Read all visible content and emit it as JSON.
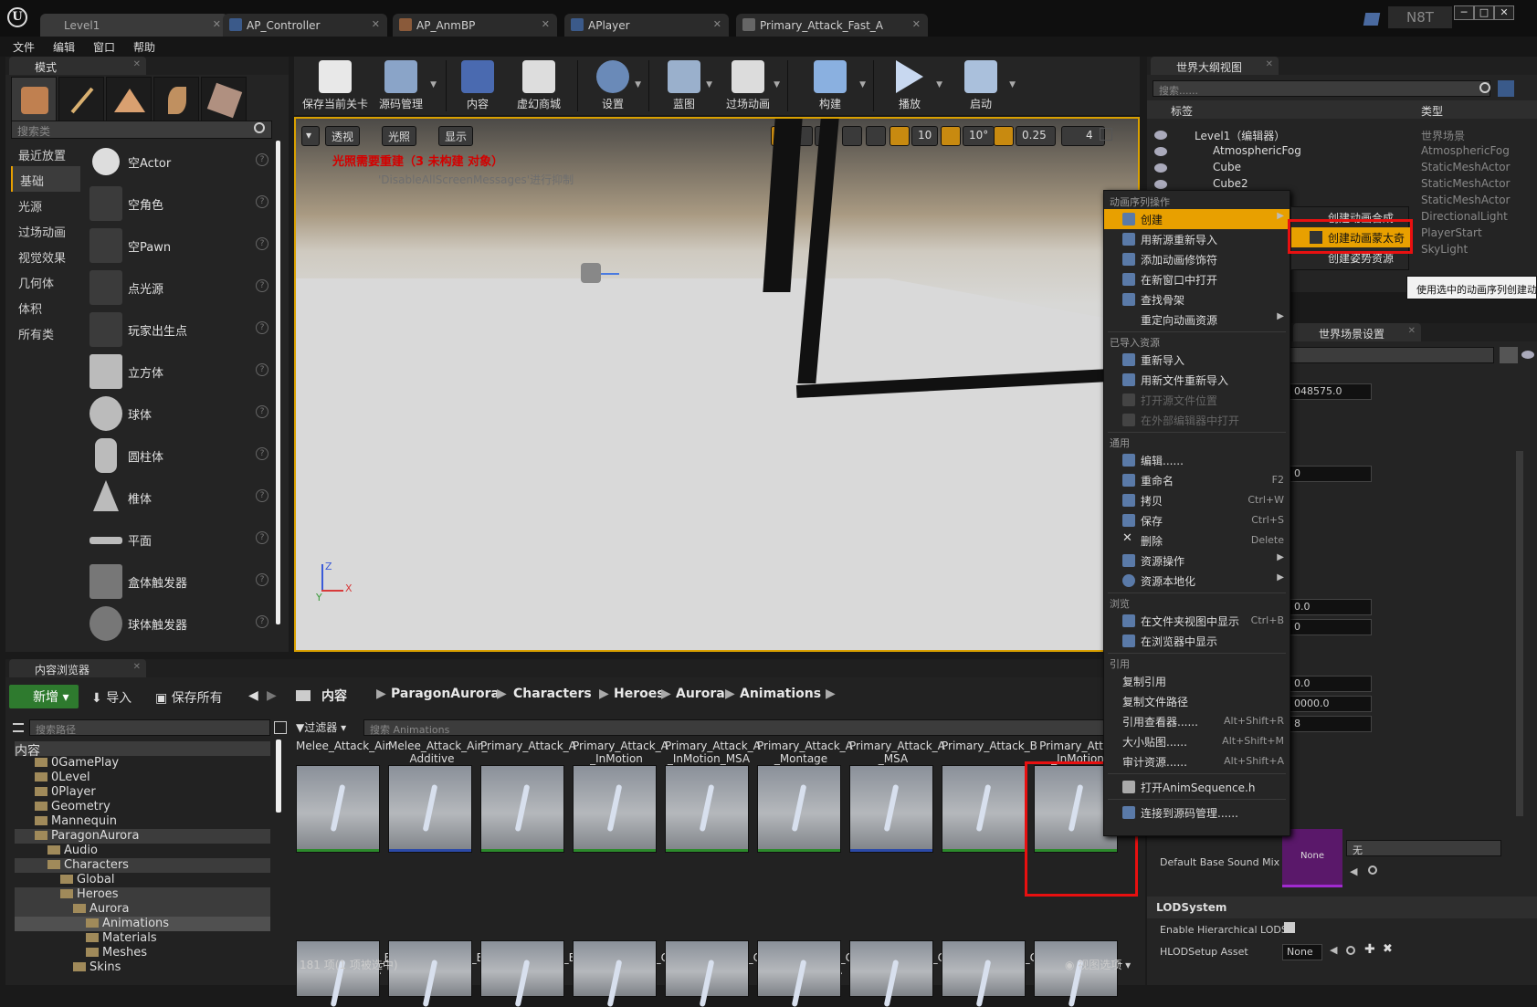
{
  "window": {
    "tabs": [
      {
        "label": "Level1"
      },
      {
        "label": "AP_Controller"
      },
      {
        "label": "AP_AnmBP"
      },
      {
        "label": "APlayer"
      },
      {
        "label": "Primary_Attack_Fast_A"
      }
    ],
    "badge": "N8T",
    "min": "─",
    "max": "□",
    "close": "✕"
  },
  "menubar": [
    "文件",
    "编辑",
    "窗口",
    "帮助"
  ],
  "modes": {
    "tab": "模式",
    "search_placeholder": "搜索类",
    "categories": [
      "最近放置",
      "基础",
      "光源",
      "过场动画",
      "视觉效果",
      "几何体",
      "体积",
      "所有类"
    ],
    "items": [
      "空Actor",
      "空角色",
      "空Pawn",
      "点光源",
      "玩家出生点",
      "立方体",
      "球体",
      "圆柱体",
      "椎体",
      "平面",
      "盒体触发器",
      "球体触发器"
    ]
  },
  "toolbar": {
    "buttons": [
      "保存当前关卡",
      "源码管理",
      "内容",
      "虚幻商城",
      "设置",
      "蓝图",
      "过场动画",
      "构建",
      "播放",
      "启动"
    ]
  },
  "viewport": {
    "perspective": "透视",
    "lit": "光照",
    "show": "显示",
    "grid": "10",
    "rot": "10°",
    "scale": "0.25",
    "cam": "4",
    "warning": "光照需要重建（3 未构建 对象）",
    "suppress": "'DisableAllScreenMessages'进行抑制",
    "axis_z": "Z",
    "axis_x": "X",
    "axis_y": "Y"
  },
  "context_menu": {
    "sections": {
      "anim": "动画序列操作",
      "imported": "已导入资源",
      "common": "通用",
      "browse": "浏览",
      "refs": "引用"
    },
    "items": {
      "create": "创建",
      "reimport_new": "用新源重新导入",
      "add_modifier": "添加动画修饰符",
      "open_new_window": "在新窗口中打开",
      "find_skeleton": "查找骨架",
      "retarget": "重定向动画资源",
      "reimport": "重新导入",
      "reimport_file": "用新文件重新导入",
      "open_source_loc": "打开源文件位置",
      "open_external": "在外部编辑器中打开",
      "edit": "编辑......",
      "rename": "重命名",
      "rename_sc": "F2",
      "copy": "拷贝",
      "copy_sc": "Ctrl+W",
      "save": "保存",
      "save_sc": "Ctrl+S",
      "delete": "删除",
      "delete_sc": "Delete",
      "asset_actions": "资源操作",
      "localize": "资源本地化",
      "show_in_folder": "在文件夹视图中显示",
      "show_in_folder_sc": "Ctrl+B",
      "show_in_browser": "在浏览器中显示",
      "copy_ref": "复制引用",
      "copy_path": "复制文件路径",
      "ref_viewer": "引用查看器......",
      "ref_viewer_sc": "Alt+Shift+R",
      "size_map": "大小贴图......",
      "size_map_sc": "Alt+Shift+M",
      "audit": "审计资源......",
      "audit_sc": "Alt+Shift+A",
      "open_h": "打开AnimSequence.h",
      "connect_scm": "连接到源码管理......"
    }
  },
  "submenu": {
    "items": [
      "创建动画合成",
      "创建动画蒙太奇",
      "创建姿势资源"
    ]
  },
  "tooltip": "使用选中的动画序列创建动画蒙太奇",
  "outliner": {
    "tab": "世界大纲视图",
    "search_placeholder": "搜索......",
    "col_label": "标签",
    "col_type": "类型",
    "rows": [
      {
        "name": "Level1（编辑器）",
        "type": "世界场景"
      },
      {
        "name": "AtmosphericFog",
        "type": "AtmosphericFog"
      },
      {
        "name": "Cube",
        "type": "StaticMeshActor"
      },
      {
        "name": "Cube2",
        "type": "StaticMeshActor"
      },
      {
        "name": "",
        "type": "StaticMeshActor"
      },
      {
        "name": "",
        "type": "DirectionalLight"
      },
      {
        "name": "",
        "type": "PlayerStart"
      },
      {
        "name": "",
        "type": "SkyLight"
      }
    ]
  },
  "details": {
    "tab": "世界场景设置",
    "vals": [
      "048575.0",
      "0",
      "0.0",
      "0",
      "0.0",
      "0000.0",
      "8"
    ],
    "sound_label": "Default Base Sound Mix",
    "sound_thumb": "None",
    "sound_combo": "无",
    "lod_section": "LODSystem",
    "hlod_label": "Enable Hierarchical LODS",
    "hlod_setup": "HLODSetup Asset",
    "hlod_combo": "None"
  },
  "content_browser": {
    "tab": "内容浏览器",
    "new": "新增",
    "import": "导入",
    "save_all": "保存所有",
    "breadcrumb": [
      "内容",
      "ParagonAurora",
      "Characters",
      "Heroes",
      "Aurora",
      "Animations"
    ],
    "path_search": "搜索路径",
    "filter": "过滤器",
    "asset_search": "搜索 Animations",
    "tree": [
      {
        "label": "内容",
        "depth": 0
      },
      {
        "label": "0GamePlay",
        "depth": 1
      },
      {
        "label": "0Level",
        "depth": 1
      },
      {
        "label": "0Player",
        "depth": 1
      },
      {
        "label": "Geometry",
        "depth": 1
      },
      {
        "label": "Mannequin",
        "depth": 1
      },
      {
        "label": "ParagonAurora",
        "depth": 1
      },
      {
        "label": "Audio",
        "depth": 2
      },
      {
        "label": "Characters",
        "depth": 2
      },
      {
        "label": "Global",
        "depth": 3
      },
      {
        "label": "Heroes",
        "depth": 3
      },
      {
        "label": "Aurora",
        "depth": 4
      },
      {
        "label": "Animations",
        "depth": 5
      },
      {
        "label": "Materials",
        "depth": 5
      },
      {
        "label": "Meshes",
        "depth": 5
      },
      {
        "label": "Skins",
        "depth": 4
      }
    ],
    "row1_names": [
      "Melee_Attack_Air",
      "Melee_Attack_Air_ Additive",
      "Primary_Attack_A",
      "Primary_Attack_A _InMotion",
      "Primary_Attack_A _InMotion_MSA",
      "Primary_Attack_A _Montage",
      "Primary_Attack_A _MSA",
      "Primary_Attack_B",
      "Primary_Attac _InMotion"
    ],
    "row2_names": [
      "Primary_Attack_B _InMotion_MSA",
      "Primary_Attack_B _Montage",
      "Primary_Attack_B _MSA",
      "Primary_Attack_C",
      "Primary_Attack_C _InMotion",
      "Primary_Attack_C _InMotion_MSA",
      "Primary_Attack_C _Montage",
      "Primary_Attack_C _MSA",
      "Primary_Attack_ Fast_A"
    ],
    "status": "181 项(1 项被选中)",
    "view_options": "视图选项"
  }
}
